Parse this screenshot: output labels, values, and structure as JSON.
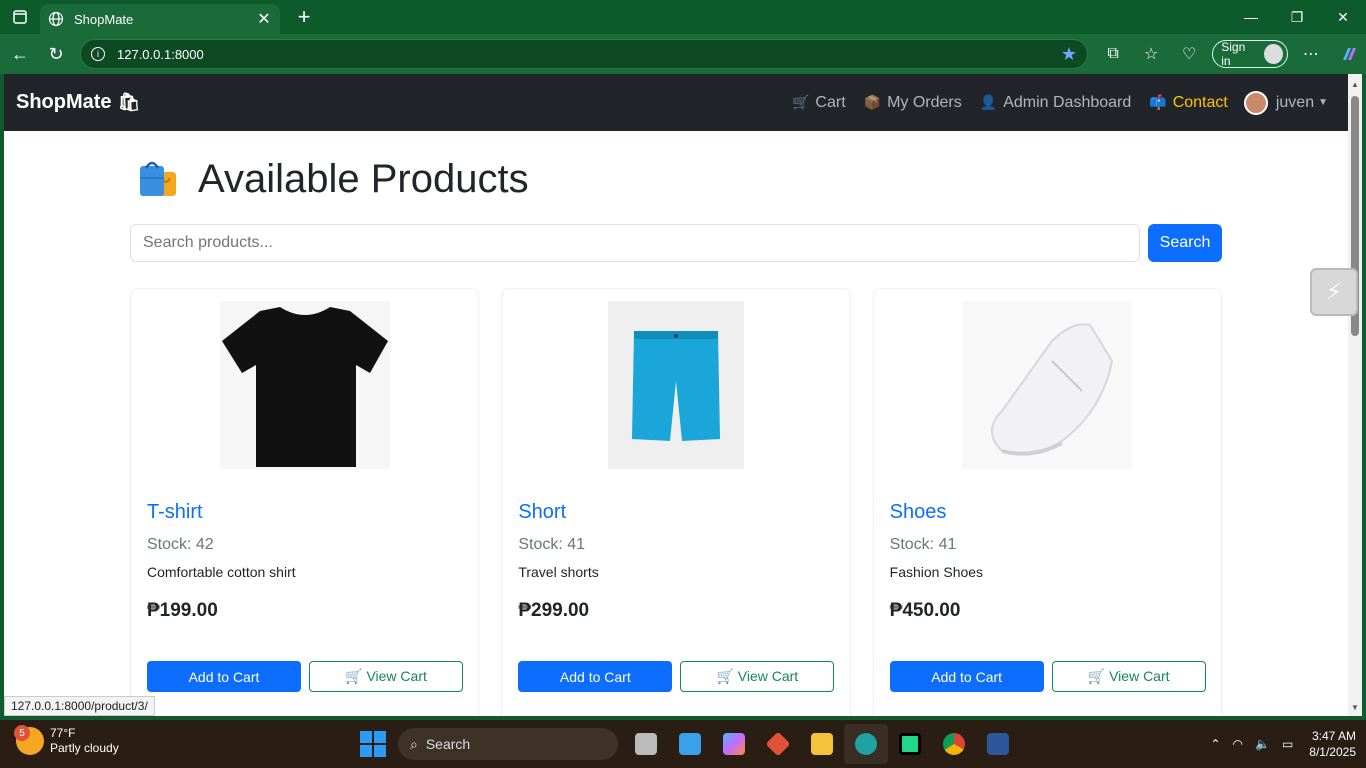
{
  "browser": {
    "tab_title": "ShopMate",
    "url": "127.0.0.1:8000",
    "signin_label": "Sign in"
  },
  "navbar": {
    "brand": "ShopMate",
    "links": [
      {
        "label": "Cart",
        "icon": "cart-icon"
      },
      {
        "label": "My Orders",
        "icon": "package-icon"
      },
      {
        "label": "Admin Dashboard",
        "icon": "admin-icon"
      },
      {
        "label": "Contact",
        "icon": "mailbox-icon",
        "active": true
      }
    ],
    "user": "juven"
  },
  "page": {
    "title": "Available Products",
    "search_placeholder": "Search products...",
    "search_button": "Search"
  },
  "products": [
    {
      "name": "T-shirt",
      "stock": "Stock: 42",
      "description": "Comfortable cotton shirt",
      "price": "₱199.00",
      "add_label": "Add to Cart",
      "view_label": "View Cart"
    },
    {
      "name": "Short",
      "stock": "Stock: 41",
      "description": "Travel shorts",
      "price": "₱299.00",
      "add_label": "Add to Cart",
      "view_label": "View Cart"
    },
    {
      "name": "Shoes",
      "stock": "Stock: 41",
      "description": "Fashion Shoes",
      "price": "₱450.00",
      "add_label": "Add to Cart",
      "view_label": "View Cart"
    }
  ],
  "status_url": "127.0.0.1:8000/product/3/",
  "taskbar": {
    "weather_temp": "77°F",
    "weather_desc": "Partly cloudy",
    "weather_badge": "5",
    "search_label": "Search",
    "time": "3:47 AM",
    "date": "8/1/2025"
  },
  "colors": {
    "primary": "#0d6efd",
    "success": "#198754",
    "navbar": "#212529",
    "active_link": "#ffc107"
  }
}
